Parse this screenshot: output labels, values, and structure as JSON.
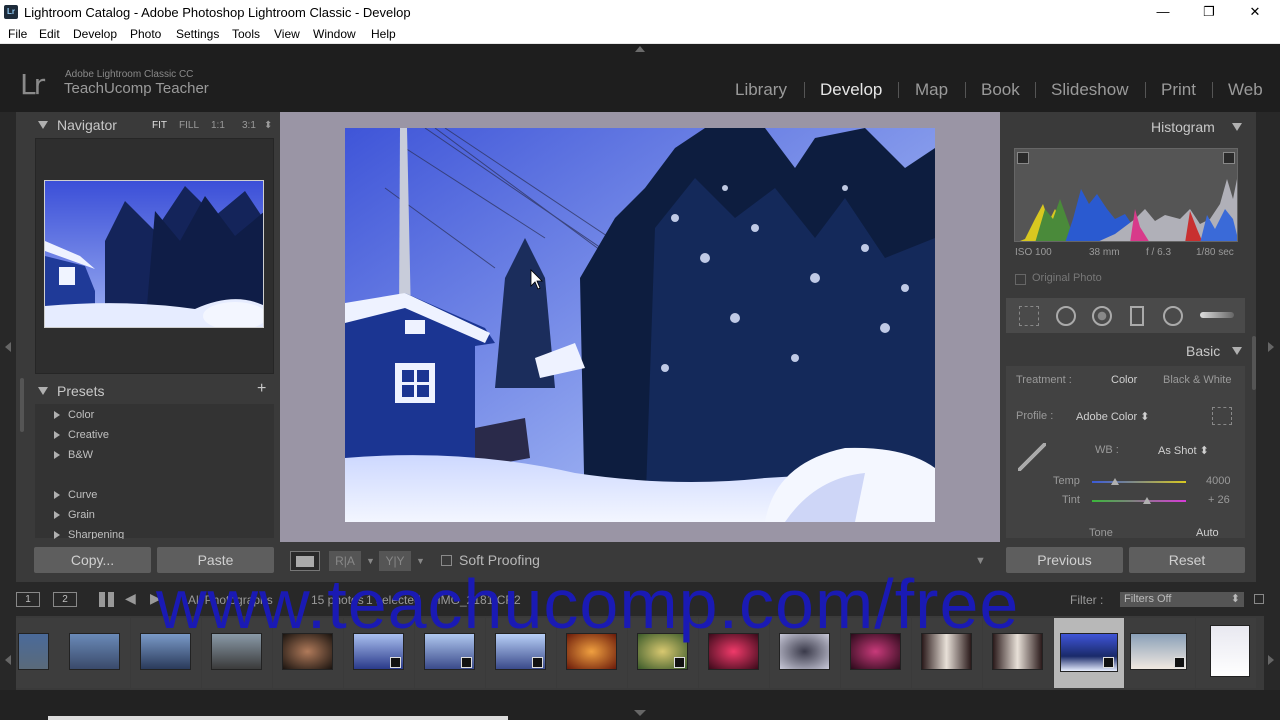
{
  "titlebar": {
    "app_icon": "Lr",
    "title": "Lightroom Catalog - Adobe Photoshop Lightroom Classic - Develop",
    "minimize": "—",
    "maximize": "❐",
    "close": "✕"
  },
  "menu": [
    "File",
    "Edit",
    "Develop",
    "Photo",
    "Settings",
    "Tools",
    "View",
    "Window",
    "Help"
  ],
  "identity": {
    "logo": "Lr",
    "product": "Adobe Lightroom Classic CC",
    "user": "TeachUcomp Teacher"
  },
  "modules": {
    "items": [
      "Library",
      "Develop",
      "Map",
      "Book",
      "Slideshow",
      "Print",
      "Web"
    ],
    "active": "Develop"
  },
  "navigator": {
    "title": "Navigator",
    "zoom": [
      "FIT",
      "FILL",
      "1:1",
      "3:1"
    ],
    "zoom_active": "FIT"
  },
  "presets": {
    "title": "Presets",
    "add": "+",
    "items": [
      "Color",
      "Creative",
      "B&W",
      "Curve",
      "Grain",
      "Sharpening"
    ]
  },
  "left_buttons": {
    "copy": "Copy...",
    "paste": "Paste"
  },
  "toolbar": {
    "before_after_1": "R|A",
    "before_after_2": "Y|Y",
    "soft_proofing": "Soft Proofing"
  },
  "histogram": {
    "title": "Histogram",
    "iso": "ISO 100",
    "focal": "38 mm",
    "aperture": "f / 6.3",
    "shutter": "1/80 sec",
    "original_photo": "Original Photo"
  },
  "basic": {
    "title": "Basic",
    "treatment_label": "Treatment :",
    "treatment_color": "Color",
    "treatment_bw": "Black & White",
    "profile_label": "Profile :",
    "profile_value": "Adobe Color ⬍",
    "wb_label": "WB :",
    "wb_value": "As Shot ⬍",
    "temp_label": "Temp",
    "temp_value": "4000",
    "tint_label": "Tint",
    "tint_value": "+ 26",
    "tone_label": "Tone",
    "tone_auto": "Auto",
    "temp_level": 0.24,
    "tint_level": 0.58
  },
  "right_buttons": {
    "previous": "Previous",
    "reset": "Reset"
  },
  "filmstrip_bar": {
    "page1": "1",
    "page2": "2",
    "source": "All Photographs",
    "count": "15 photos",
    "selected": "1 selected",
    "filename": "/IMG_2181.CR2",
    "filter_label": "Filter :",
    "filter_value": "Filters Off"
  },
  "watermark": "www.teachucomp.com/free",
  "colors": {
    "accent_selected": "#b8b8b8",
    "panel": "#3a3a3a",
    "background": "#282828",
    "watermark": "#1a1ab4"
  }
}
